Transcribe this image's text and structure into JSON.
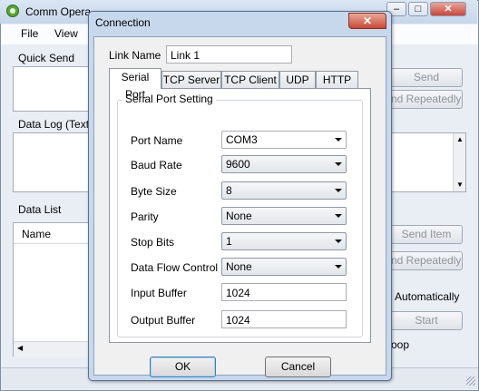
{
  "main": {
    "title": "Comm Opera",
    "menu": [
      "File",
      "View"
    ],
    "quick_send_label": "Quick Send",
    "send_button": "Send",
    "send_repeatedly_button": "nd Repeatedly",
    "data_log_label": "Data Log (Text)",
    "data_list_label": "Data List",
    "name_column": "Name",
    "send_item_button": "Send Item",
    "send_repeatedly_button_2": "nd Repeatedly",
    "automatically_label": "Automatically",
    "start_button": "Start",
    "loop_label": "oop"
  },
  "dialog": {
    "title": "Connection",
    "close_glyph": "✕",
    "link_name_label": "Link Name",
    "link_name_value": "Link 1",
    "tabs": [
      "Serial Port",
      "TCP Server",
      "TCP Client",
      "UDP",
      "HTTP"
    ],
    "group_title": "Serial Port Setting",
    "fields": {
      "port_name": {
        "label": "Port Name",
        "value": "COM3"
      },
      "baud_rate": {
        "label": "Baud Rate",
        "value": "9600"
      },
      "byte_size": {
        "label": "Byte Size",
        "value": "8"
      },
      "parity": {
        "label": "Parity",
        "value": "None"
      },
      "stop_bits": {
        "label": "Stop Bits",
        "value": "1"
      },
      "flow_control": {
        "label": "Data Flow Control",
        "value": "None"
      },
      "input_buffer": {
        "label": "Input Buffer",
        "value": "1024"
      },
      "output_buffer": {
        "label": "Output Buffer",
        "value": "1024"
      }
    },
    "ok_button": "OK",
    "cancel_button": "Cancel"
  }
}
